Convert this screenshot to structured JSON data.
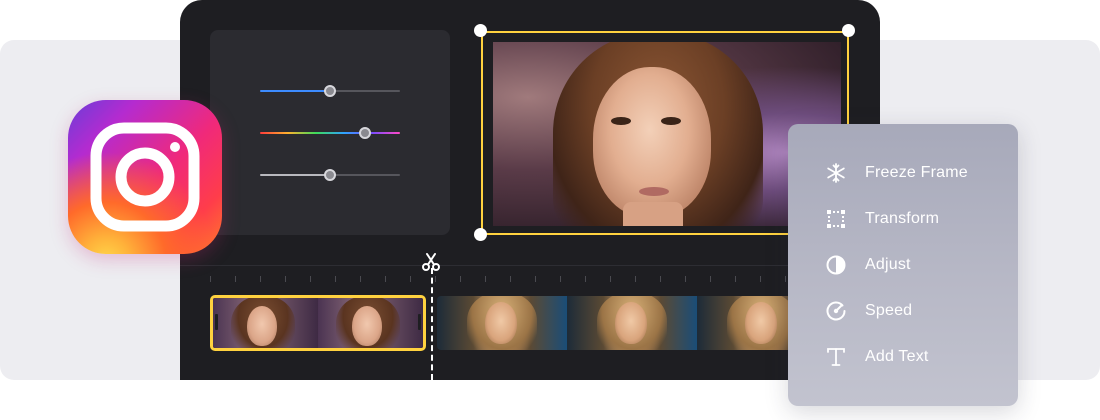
{
  "menu": {
    "items": [
      {
        "label": "Freeze Frame",
        "icon": "snowflake-icon"
      },
      {
        "label": "Transform",
        "icon": "transform-frame-icon"
      },
      {
        "label": "Adjust",
        "icon": "contrast-icon"
      },
      {
        "label": "Speed",
        "icon": "speed-gauge-icon"
      },
      {
        "label": "Add Text",
        "icon": "text-icon"
      }
    ]
  },
  "adjust_panel": {
    "sliders": [
      {
        "name": "blue-slider",
        "value": 0.5,
        "color": "#3d8cff"
      },
      {
        "name": "rainbow-slider",
        "value": 0.75,
        "color": "rainbow"
      },
      {
        "name": "gray-slider",
        "value": 0.5,
        "color": "#b9b9be"
      }
    ]
  },
  "timeline": {
    "tools": [
      "scissors-icon"
    ],
    "selected_clip_color": "#ffd23f"
  },
  "preview": {
    "selection_color": "#ffd23f"
  },
  "brand": {
    "logo": "instagram-logo"
  },
  "colors": {
    "accent": "#ffd23f",
    "editor_bg": "#1e1e22",
    "menu_bg": "#b7b8c6"
  }
}
